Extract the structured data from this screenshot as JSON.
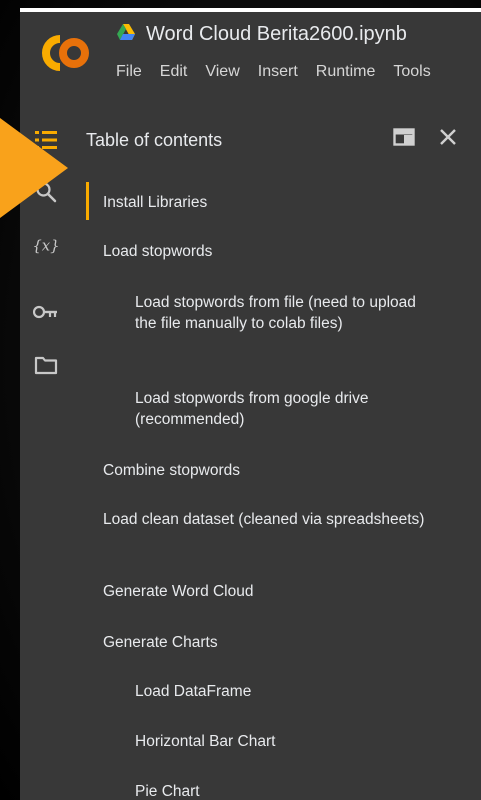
{
  "notebook": {
    "logo_text": "CO",
    "title": "Word Cloud Berita2600.ipynb"
  },
  "menubar": {
    "items": [
      "File",
      "Edit",
      "View",
      "Insert",
      "Runtime",
      "Tools"
    ]
  },
  "sidebar": {
    "icons": [
      "table-of-contents-icon",
      "search-icon",
      "variables-icon",
      "key-icon",
      "folder-icon"
    ]
  },
  "panel": {
    "title": "Table of contents",
    "toc": [
      {
        "label": "Install Libraries",
        "level": 1,
        "active": true
      },
      {
        "label": "Load stopwords",
        "level": 1
      },
      {
        "label": "Load stopwords from file (need to upload the file manually to colab files)",
        "level": 2
      },
      {
        "label": "Load stopwords from google drive (recommended)",
        "level": 2
      },
      {
        "label": "Combine stopwords",
        "level": 1
      },
      {
        "label": "Load clean dataset (cleaned via spreadsheets)",
        "level": 1
      },
      {
        "label": "Generate Word Cloud",
        "level": 1
      },
      {
        "label": "Generate Charts",
        "level": 1
      },
      {
        "label": "Load DataFrame",
        "level": 2
      },
      {
        "label": "Horizontal Bar Chart",
        "level": 2
      },
      {
        "label": "Pie Chart",
        "level": 2
      }
    ]
  },
  "colors": {
    "accent": "#f9ab00",
    "background": "#383838",
    "text": "#e8eaed"
  }
}
